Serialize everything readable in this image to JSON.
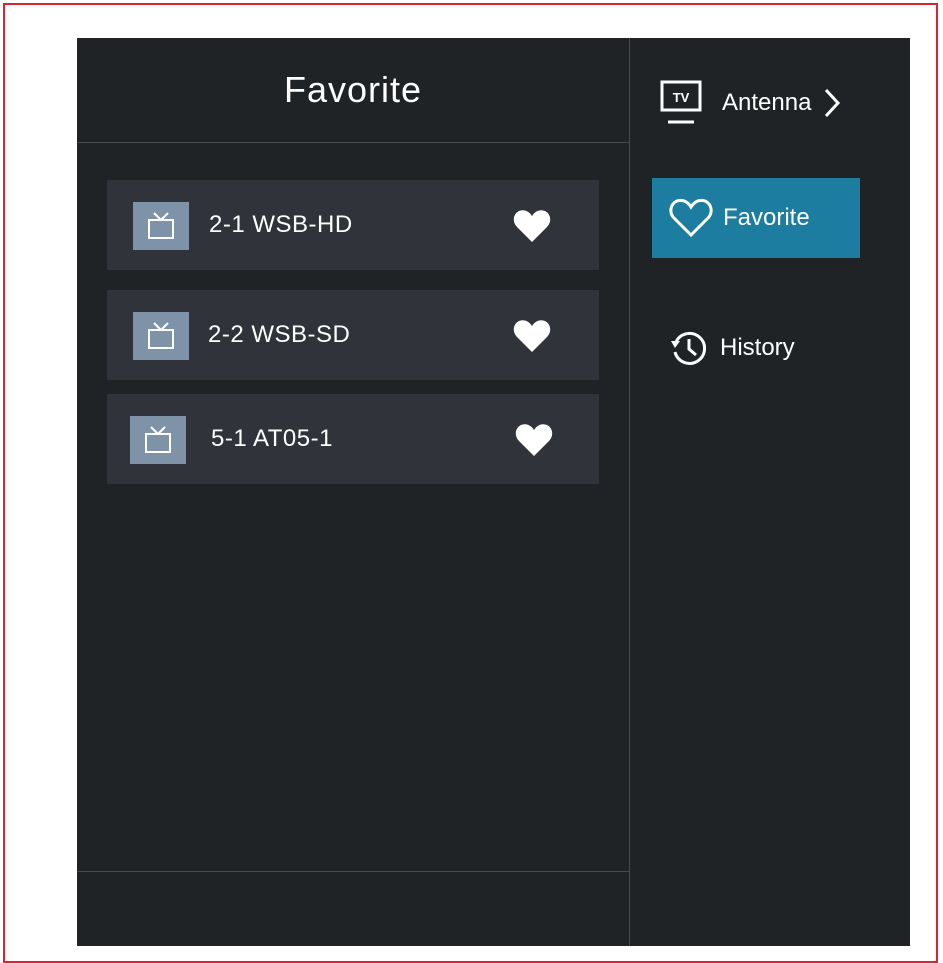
{
  "left_panel": {
    "title": "Favorite",
    "channels": [
      {
        "label": "2-1 WSB-HD",
        "icon": "tv-icon",
        "favorite_icon": "heart-icon"
      },
      {
        "label": "2-2 WSB-SD",
        "icon": "tv-icon",
        "favorite_icon": "heart-icon"
      },
      {
        "label": "5-1 AT05-1",
        "icon": "tv-icon",
        "favorite_icon": "heart-icon"
      }
    ]
  },
  "right_nav": {
    "antenna": {
      "label": "Antenna",
      "icon": "tv-screen-icon",
      "chevron_icon": "chevron-right-icon"
    },
    "favorite": {
      "label": "Favorite",
      "icon": "heart-outline-icon"
    },
    "history": {
      "label": "History",
      "icon": "history-clock-icon"
    }
  },
  "colors": {
    "frame_border": "#d9232e",
    "background": "#202326",
    "item_background": "#30343a",
    "icon_box": "#7e93a7",
    "accent": "#1c7da0",
    "divider": "#474a4e",
    "text": "#ffffff"
  }
}
